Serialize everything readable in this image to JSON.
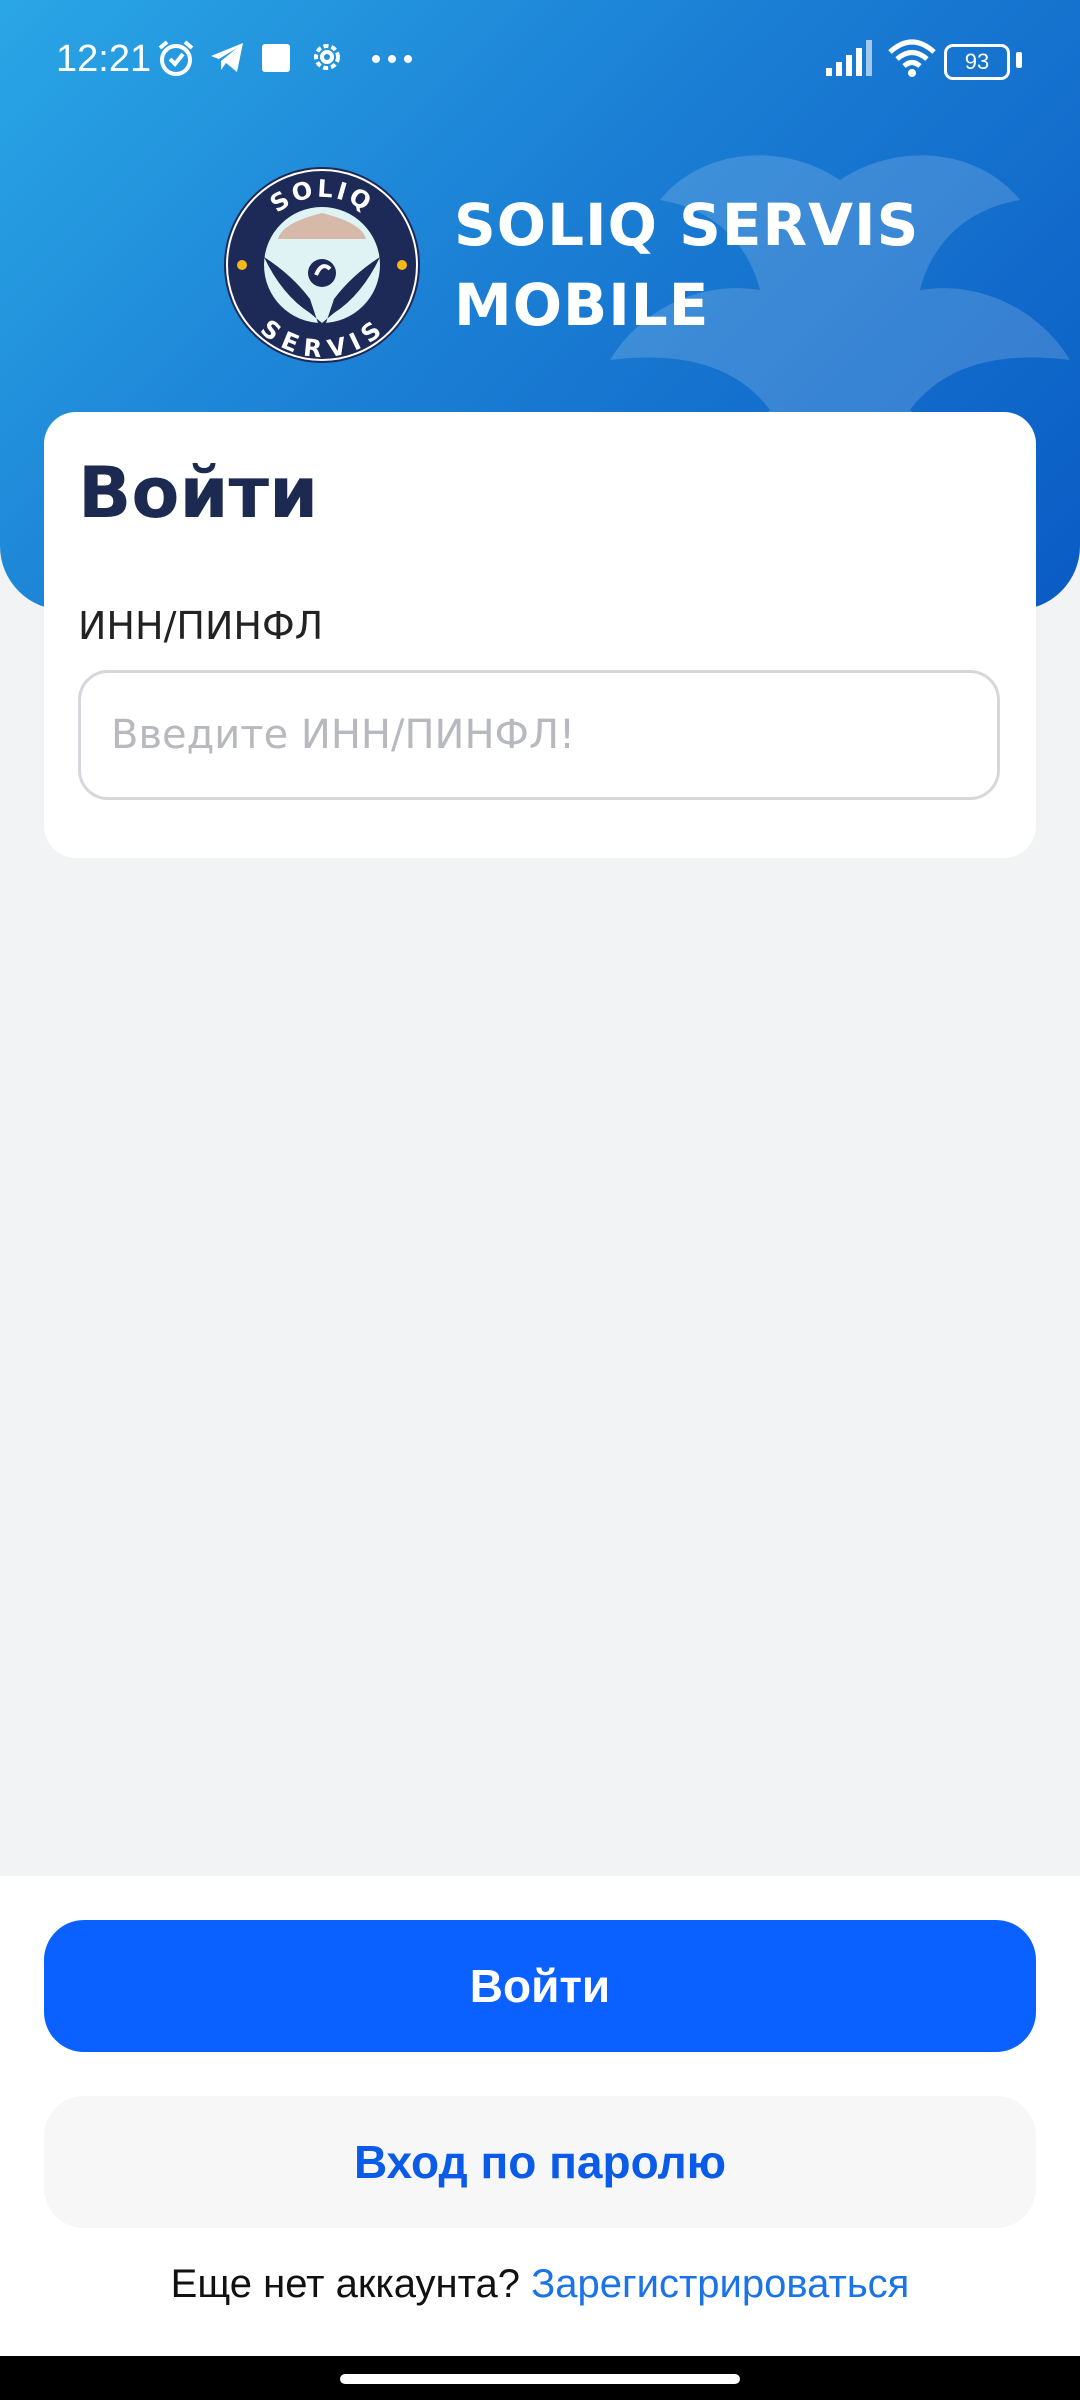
{
  "status_bar": {
    "time": "12:21",
    "battery": "93",
    "icons": [
      "alarm-icon",
      "telegram-icon",
      "square-icon",
      "gear-icon",
      "more-icon",
      "signal-icon",
      "wifi-icon",
      "battery-icon"
    ]
  },
  "header": {
    "brand_line1": "SOLIQ SERVIS",
    "brand_line2": "MOBILE",
    "logo_text_top": "SOLIQ",
    "logo_text_bottom": "SERVIS"
  },
  "login_card": {
    "title": "Войти",
    "field_label": "ИНН/ПИНФЛ",
    "field_placeholder": "Введите ИНН/ПИНФЛ!",
    "field_value": ""
  },
  "actions": {
    "login_button": "Войти",
    "password_login_button": "Вход по паролю",
    "no_account_text": "Еще нет аккаунта?",
    "register_link": "Зарегистрироваться"
  },
  "colors": {
    "header_gradient_start": "#2aa6e6",
    "header_gradient_end": "#0a5bc4",
    "primary": "#0a61ff",
    "title_text": "#1c2a52",
    "link": "#1a73e8"
  }
}
